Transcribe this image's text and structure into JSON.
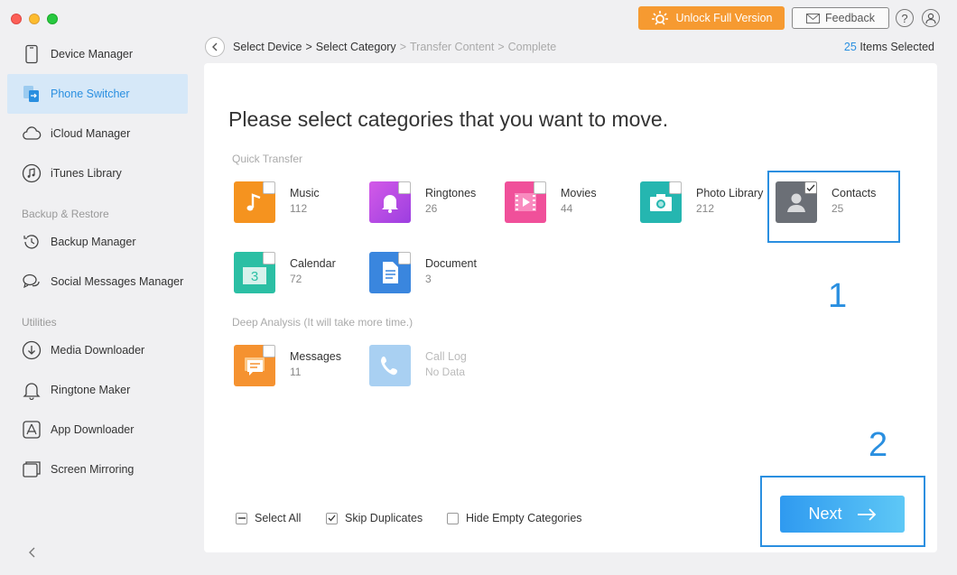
{
  "window": {
    "controls": [
      "close",
      "minimize",
      "zoom"
    ]
  },
  "header": {
    "unlock_label": "Unlock Full Version",
    "feedback_label": "Feedback",
    "help_glyph": "?"
  },
  "sidebar": {
    "items": [
      {
        "label": "Device Manager",
        "icon": "phone-icon"
      },
      {
        "label": "Phone Switcher",
        "icon": "phone-switch-icon",
        "active": true
      },
      {
        "label": "iCloud Manager",
        "icon": "cloud-icon"
      },
      {
        "label": "iTunes Library",
        "icon": "music-note-icon"
      }
    ],
    "section_backup": "Backup & Restore",
    "backup_items": [
      {
        "label": "Backup Manager",
        "icon": "clock-icon"
      },
      {
        "label": "Social Messages Manager",
        "icon": "chat-icon"
      }
    ],
    "section_utilities": "Utilities",
    "utility_items": [
      {
        "label": "Media Downloader",
        "icon": "download-icon"
      },
      {
        "label": "Ringtone Maker",
        "icon": "bell-icon"
      },
      {
        "label": "App Downloader",
        "icon": "app-store-icon"
      },
      {
        "label": "Screen Mirroring",
        "icon": "mirror-icon"
      }
    ]
  },
  "breadcrumb": {
    "steps": [
      "Select Device",
      "Select Category",
      "Transfer Content",
      "Complete"
    ],
    "separator": ">",
    "current_index": 1
  },
  "selection": {
    "count": "25",
    "label": "Items Selected"
  },
  "main": {
    "prompt": "Please select categories that you want to move.",
    "quick_label": "Quick Transfer",
    "deep_label": "Deep Analysis (It will take more time.)",
    "quick_categories": [
      {
        "name": "Music",
        "count": "112",
        "color": "#f5931f",
        "icon": "music-note-icon",
        "checked": false
      },
      {
        "name": "Ringtones",
        "count": "26",
        "color": "#b44ee6",
        "icon": "bell-icon",
        "checked": false
      },
      {
        "name": "Movies",
        "count": "44",
        "color": "#f0509a",
        "icon": "film-icon",
        "checked": false
      },
      {
        "name": "Photo Library",
        "count": "212",
        "color": "#25b6b0",
        "icon": "camera-icon",
        "checked": false
      },
      {
        "name": "Contacts",
        "count": "25",
        "color": "#6b6f76",
        "icon": "contact-icon",
        "checked": true
      },
      {
        "name": "Calendar",
        "count": "72",
        "color": "#2bbfa4",
        "icon": "calendar-icon",
        "checked": false
      },
      {
        "name": "Document",
        "count": "3",
        "color": "#3a86de",
        "icon": "document-icon",
        "checked": false
      }
    ],
    "deep_categories": [
      {
        "name": "Messages",
        "count": "11",
        "color": "#f59230",
        "icon": "message-icon",
        "checked": false,
        "disabled": false
      },
      {
        "name": "Call Log",
        "count": "No Data",
        "color": "#a9d0f2",
        "icon": "phone-call-icon",
        "checked": false,
        "disabled": true
      }
    ],
    "calendar_day": "3",
    "options": [
      {
        "label": "Select All",
        "state": "mixed"
      },
      {
        "label": "Skip Duplicates",
        "state": "checked"
      },
      {
        "label": "Hide Empty Categories",
        "state": "unchecked"
      }
    ],
    "next_label": "Next",
    "annotations": [
      "1",
      "2"
    ]
  },
  "colors": {
    "accent": "#2a8fe0",
    "unlock": "#f69a31",
    "active_bg": "#d6e8f8"
  }
}
